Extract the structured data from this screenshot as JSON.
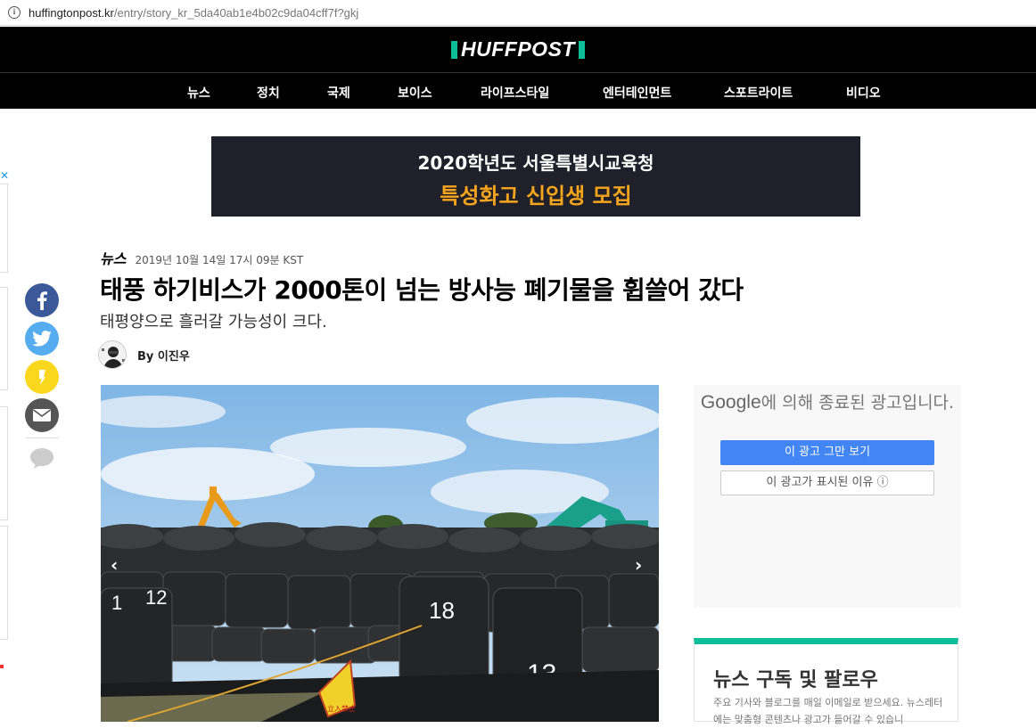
{
  "browser": {
    "url_host": "huffingtonpost.kr",
    "url_path": "/entry/story_kr_5da40ab1e4b02c9da04cff7f?gkj"
  },
  "site": {
    "logo": "HUFFPOST",
    "nav": [
      "뉴스",
      "정치",
      "국제",
      "보이스",
      "라이프스타일",
      "엔터테인먼트",
      "스포트라이트",
      "비디오"
    ]
  },
  "banner": {
    "line1": "2020학년도 서울특별시교육청",
    "line2": "특성화고 신입생 모집"
  },
  "article": {
    "section": "뉴스",
    "date": "2019년 10월 14일 17시 09분 KST",
    "headline": "태풍 하기비스가 2000톤이 넘는 방사능 폐기물을 휩쓸어 갔다",
    "subhead": "태평양으로 흘러갈 가능성이 크다.",
    "byline": "By 이진우"
  },
  "photo": {
    "bag_numbers": [
      "1",
      "12",
      "18",
      "13"
    ],
    "sign_text": "立入禁止"
  },
  "ad_closed": {
    "google": "Google",
    "message": "에 의해 종료된 광고입니다.",
    "stop_button": "이 광고 그만 보기",
    "why_button": "이 광고가 표시된 이유 ⓘ"
  },
  "subscribe": {
    "title": "뉴스 구독 및 팔로우",
    "desc": "주요 기사와 블로그를 매일 이메일로 받으세요. 뉴스레터에는 맞춤형 콘텐츠나 광고가 들어갈 수 있습니"
  },
  "colors": {
    "accent": "#0dbe98",
    "facebook": "#3b5998",
    "twitter": "#55acee",
    "kakao": "#f9d71c",
    "email": "#555555"
  }
}
